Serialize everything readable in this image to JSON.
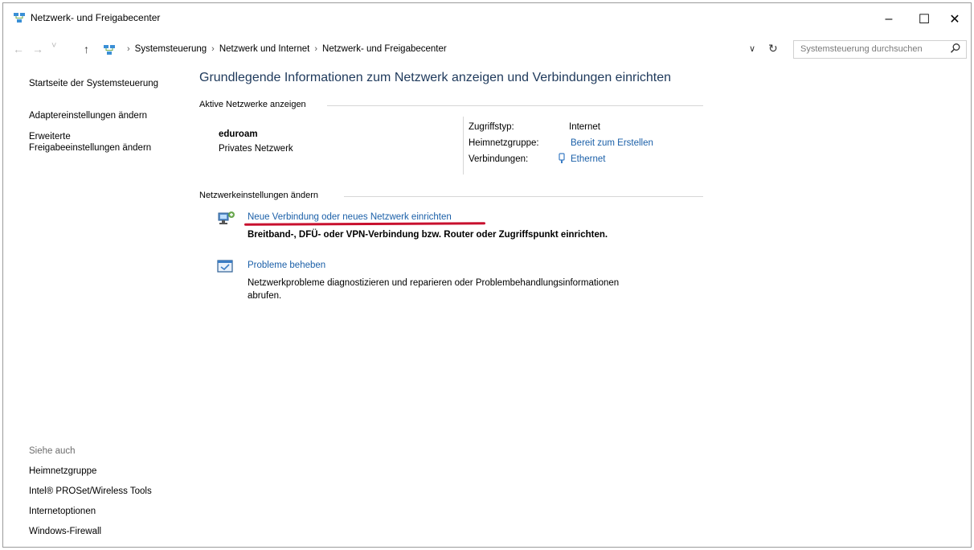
{
  "window": {
    "title": "Netzwerk- und Freigabecenter",
    "minimize_glyph": "–",
    "maximize_glyph": "☐",
    "close_glyph": "✕"
  },
  "addressbar": {
    "back_glyph": "←",
    "forward_glyph": "→",
    "recent_glyph": "˅",
    "up_glyph": "↑",
    "breadcrumbs": [
      "Systemsteuerung",
      "Netzwerk und Internet",
      "Netzwerk- und Freigabecenter"
    ],
    "separator": "›",
    "dropdown_glyph": "∨",
    "refresh_glyph": "↻",
    "search_placeholder": "Systemsteuerung durchsuchen",
    "search_icon": "search-icon"
  },
  "sidebar": {
    "items": [
      "Startseite der Systemsteuerung",
      "Adaptereinstellungen ändern",
      "Erweiterte",
      "Freigabeeinstellungen ändern"
    ],
    "see_also_title": "Siehe auch",
    "see_also": [
      "Heimnetzgruppe",
      "Intel® PROSet/Wireless Tools",
      "Internetoptionen",
      "Windows-Firewall"
    ]
  },
  "main": {
    "heading": "Grundlegende Informationen zum Netzwerk anzeigen und Verbindungen einrichten",
    "active_section_title": "Aktive Netzwerke anzeigen",
    "network": {
      "name": "eduroam",
      "type": "Privates Netzwerk",
      "access_label": "Zugriffstyp:",
      "access_value": "Internet",
      "homegroup_label": "Heimnetzgruppe:",
      "homegroup_value": "Bereit zum Erstellen",
      "connections_label": "Verbindungen:",
      "connections_value": "Ethernet"
    },
    "change_section_title": "Netzwerkeinstellungen ändern",
    "tasks": [
      {
        "link": "Neue Verbindung oder neues Netzwerk einrichten",
        "desc": "Breitband-, DFÜ- oder VPN-Verbindung bzw. Router oder Zugriffspunkt einrichten."
      },
      {
        "link": "Probleme beheben",
        "desc_line1": "Netzwerkprobleme diagnostizieren und reparieren oder Problembehandlungsinformationen",
        "desc_line2": "abrufen."
      }
    ]
  },
  "colors": {
    "heading": "#1e395b",
    "link": "#1a5fa8",
    "annotation": "#c8102e"
  }
}
